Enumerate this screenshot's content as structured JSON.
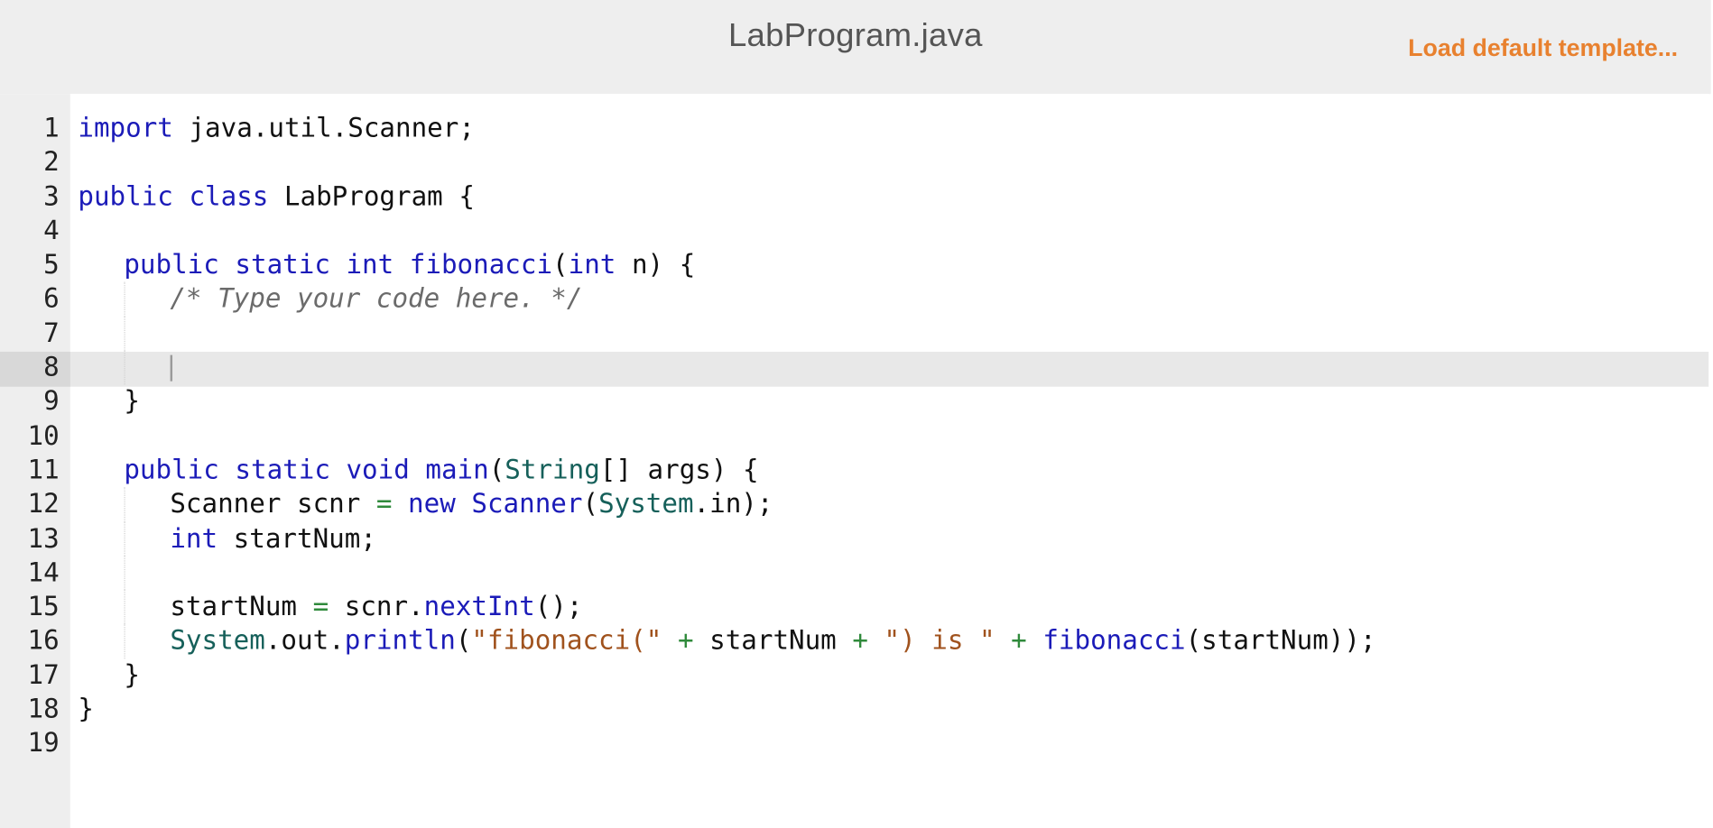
{
  "header": {
    "file_name": "LabProgram.java",
    "load_button_label": "Load default template..."
  },
  "editor": {
    "active_line": 8,
    "lines": [
      {
        "num": "1",
        "indent": 0,
        "tokens": [
          {
            "c": "kw",
            "t": "import"
          },
          {
            "c": "",
            "t": " java.util.Scanner;"
          }
        ]
      },
      {
        "num": "2",
        "indent": 0,
        "tokens": []
      },
      {
        "num": "3",
        "indent": 0,
        "tokens": [
          {
            "c": "kw",
            "t": "public class"
          },
          {
            "c": "",
            "t": " LabProgram {"
          }
        ]
      },
      {
        "num": "4",
        "indent": 0,
        "tokens": []
      },
      {
        "num": "5",
        "indent": 1,
        "tokens": [
          {
            "c": "kw",
            "t": "public static int"
          },
          {
            "c": "",
            "t": " "
          },
          {
            "c": "fn",
            "t": "fibonacci"
          },
          {
            "c": "",
            "t": "("
          },
          {
            "c": "kw",
            "t": "int"
          },
          {
            "c": "",
            "t": " n) {"
          }
        ]
      },
      {
        "num": "6",
        "indent": 2,
        "tokens": [
          {
            "c": "cm",
            "t": "/* Type your code here. */"
          }
        ]
      },
      {
        "num": "7",
        "indent": 2,
        "tokens": []
      },
      {
        "num": "8",
        "indent": 2,
        "tokens": []
      },
      {
        "num": "9",
        "indent": 1,
        "tokens": [
          {
            "c": "",
            "t": "}"
          }
        ]
      },
      {
        "num": "10",
        "indent": 0,
        "tokens": []
      },
      {
        "num": "11",
        "indent": 1,
        "tokens": [
          {
            "c": "kw",
            "t": "public static void"
          },
          {
            "c": "",
            "t": " "
          },
          {
            "c": "fn",
            "t": "main"
          },
          {
            "c": "",
            "t": "("
          },
          {
            "c": "ty",
            "t": "String"
          },
          {
            "c": "",
            "t": "[] args) {"
          }
        ]
      },
      {
        "num": "12",
        "indent": 2,
        "tokens": [
          {
            "c": "",
            "t": "Scanner scnr "
          },
          {
            "c": "op",
            "t": "="
          },
          {
            "c": "",
            "t": " "
          },
          {
            "c": "kw",
            "t": "new"
          },
          {
            "c": "",
            "t": " "
          },
          {
            "c": "fn",
            "t": "Scanner"
          },
          {
            "c": "",
            "t": "("
          },
          {
            "c": "ty",
            "t": "System"
          },
          {
            "c": "",
            "t": ".in);"
          }
        ]
      },
      {
        "num": "13",
        "indent": 2,
        "tokens": [
          {
            "c": "kw",
            "t": "int"
          },
          {
            "c": "",
            "t": " startNum;"
          }
        ]
      },
      {
        "num": "14",
        "indent": 2,
        "tokens": []
      },
      {
        "num": "15",
        "indent": 2,
        "tokens": [
          {
            "c": "",
            "t": "startNum "
          },
          {
            "c": "op",
            "t": "="
          },
          {
            "c": "",
            "t": " scnr."
          },
          {
            "c": "fn",
            "t": "nextInt"
          },
          {
            "c": "",
            "t": "();"
          }
        ]
      },
      {
        "num": "16",
        "indent": 2,
        "tokens": [
          {
            "c": "ty",
            "t": "System"
          },
          {
            "c": "",
            "t": ".out."
          },
          {
            "c": "fn",
            "t": "println"
          },
          {
            "c": "",
            "t": "("
          },
          {
            "c": "st",
            "t": "\"fibonacci(\""
          },
          {
            "c": "",
            "t": " "
          },
          {
            "c": "op",
            "t": "+"
          },
          {
            "c": "",
            "t": " startNum "
          },
          {
            "c": "op",
            "t": "+"
          },
          {
            "c": "",
            "t": " "
          },
          {
            "c": "st",
            "t": "\") is \""
          },
          {
            "c": "",
            "t": " "
          },
          {
            "c": "op",
            "t": "+"
          },
          {
            "c": "",
            "t": " "
          },
          {
            "c": "fn",
            "t": "fibonacci"
          },
          {
            "c": "",
            "t": "(startNum));"
          }
        ]
      },
      {
        "num": "17",
        "indent": 1,
        "tokens": [
          {
            "c": "",
            "t": "}"
          }
        ]
      },
      {
        "num": "18",
        "indent": 0,
        "tokens": [
          {
            "c": "",
            "t": "}"
          }
        ]
      },
      {
        "num": "19",
        "indent": 0,
        "tokens": []
      }
    ]
  },
  "colors": {
    "keyword": "#1b1bb8",
    "type": "#16605a",
    "comment": "#6b6b6b",
    "string": "#a0521d",
    "operator": "#2f8a3b",
    "load_button": "#e8812f"
  }
}
